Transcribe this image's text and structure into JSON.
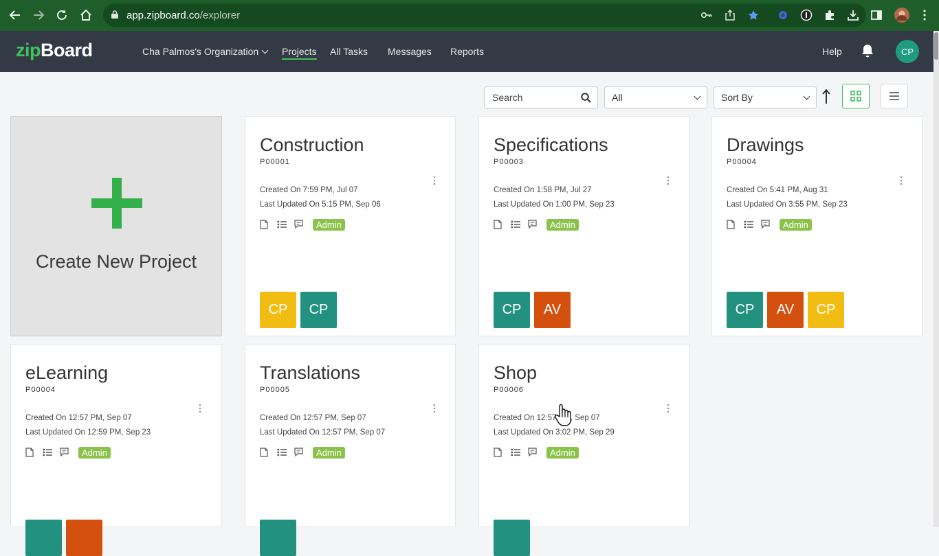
{
  "browser": {
    "url_host": "app.zipboard.co",
    "url_path": "/explorer"
  },
  "header": {
    "logo_zip": "zip",
    "logo_board": "Board",
    "org_label": "Cha Palmos's Organization",
    "nav": [
      "Projects",
      "All Tasks",
      "Messages",
      "Reports"
    ],
    "help_label": "Help",
    "user_initials": "CP"
  },
  "toolbar": {
    "search_placeholder": "Search",
    "filter_value": "All",
    "sort_value": "Sort By"
  },
  "create_card": {
    "label": "Create New Project"
  },
  "colors": {
    "teal": "#23917f",
    "yellow": "#f2bd13",
    "orange": "#d4500f",
    "accent": "#3fc25b",
    "badge": "#8bc34a"
  },
  "projects": [
    {
      "title": "Construction",
      "id": "P00001",
      "created": "Created On 7:59 PM, Jul 07",
      "updated": "Last Updated On 5:15 PM, Sep 06",
      "role": "Admin",
      "members": [
        {
          "initials": "CP",
          "color": "#f2bd13"
        },
        {
          "initials": "CP",
          "color": "#23917f"
        }
      ]
    },
    {
      "title": "Specifications",
      "id": "P00003",
      "created": "Created On 1:58 PM, Jul 27",
      "updated": "Last Updated On 1:00 PM, Sep 23",
      "role": "Admin",
      "members": [
        {
          "initials": "CP",
          "color": "#23917f"
        },
        {
          "initials": "AV",
          "color": "#d4500f"
        }
      ]
    },
    {
      "title": "Drawings",
      "id": "P00004",
      "created": "Created On 5:41 PM, Aug 31",
      "updated": "Last Updated On 3:55 PM, Sep 23",
      "role": "Admin",
      "members": [
        {
          "initials": "CP",
          "color": "#23917f"
        },
        {
          "initials": "AV",
          "color": "#d4500f"
        },
        {
          "initials": "CP",
          "color": "#f2bd13"
        }
      ]
    },
    {
      "title": "eLearning",
      "id": "P00004",
      "created": "Created On 12:57 PM, Sep 07",
      "updated": "Last Updated On 12:59 PM, Sep 23",
      "role": "Admin",
      "members": [
        {
          "initials": "",
          "color": "#23917f"
        },
        {
          "initials": "",
          "color": "#d4500f"
        }
      ]
    },
    {
      "title": "Translations",
      "id": "P00005",
      "created": "Created On 12:57 PM, Sep 07",
      "updated": "Last Updated On 12:57 PM, Sep 07",
      "role": "Admin",
      "members": [
        {
          "initials": "",
          "color": "#23917f"
        }
      ]
    },
    {
      "title": "Shop",
      "id": "P00006",
      "created": "Created On 12:57 PM, Sep 07",
      "updated": "Last Updated On 3:02 PM, Sep 29",
      "role": "Admin",
      "members": [
        {
          "initials": "",
          "color": "#23917f"
        }
      ]
    }
  ]
}
